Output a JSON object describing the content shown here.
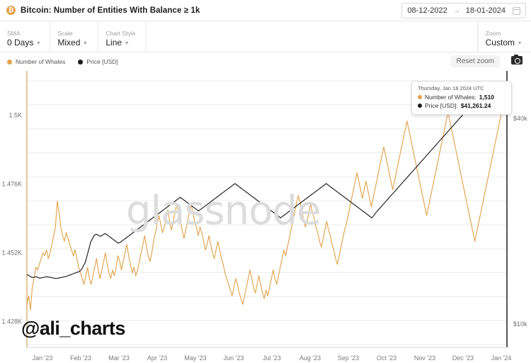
{
  "header": {
    "asset_icon": "bitcoin-icon",
    "title": "Bitcoin: Number of Entities With Balance ≥ 1k",
    "date_from": "08-12-2022",
    "date_to": "18-01-2024",
    "date_arrow": "→",
    "calendar_icon": "calendar-icon"
  },
  "controls": [
    {
      "label": "SMA",
      "value": "0 Days"
    },
    {
      "label": "Scale",
      "value": "Mixed"
    },
    {
      "label": "Chart Style",
      "value": "Line"
    }
  ],
  "zoom_control": {
    "label": "Zoom",
    "value": "Custom"
  },
  "legend": [
    {
      "label": "Number of Whales",
      "color": "#e2a44d"
    },
    {
      "label": "Price [USD]",
      "color": "#1c1c1c"
    }
  ],
  "toolbar": {
    "reset_zoom_label": "Reset zoom",
    "camera_icon": "camera-icon"
  },
  "tooltip": {
    "date": "Thursday, Jan 18 2024 UTC",
    "rows": [
      {
        "label": "Number of Whales:",
        "value": "1,510",
        "color": "#e2a44d"
      },
      {
        "label": "Price [USD]:",
        "value": "$41,261.24",
        "color": "#1c1c1c"
      }
    ]
  },
  "watermark": "glassnode",
  "handle": "@ali_charts",
  "chart_data": {
    "type": "line",
    "title": "Bitcoin: Number of Entities With Balance ≥ 1k",
    "xlabel": "",
    "ylabel": "Number of Whales",
    "y2label": "Price [USD]",
    "grid": true,
    "legend_position": "top-left",
    "x_range": [
      "2022-12-08",
      "2024-01-18"
    ],
    "x_tick_labels": [
      "Jan '23",
      "Feb '23",
      "Mar '23",
      "Apr '23",
      "May '23",
      "Jun '23",
      "Jul '23",
      "Aug '23",
      "Sep '23",
      "Oct '23",
      "Nov '23",
      "Dec '23",
      "Jan '24"
    ],
    "y_left_ticks": [
      "1.5K",
      "1.476K",
      "1.452K",
      "1.428K"
    ],
    "y_left_values": [
      1500,
      1476,
      1452,
      1428
    ],
    "ylim": [
      1420,
      1512
    ],
    "y_right_ticks": [
      "$40k",
      "$10k"
    ],
    "y_right_values": [
      40000,
      10000
    ],
    "y2lim": [
      7000,
      45500
    ],
    "series": [
      {
        "name": "Number of Whales",
        "color": "#e2a44d",
        "axis": "left",
        "values": [
          1434,
          1437,
          1432,
          1440,
          1443,
          1447,
          1446,
          1448,
          1450,
          1452,
          1451,
          1453,
          1450,
          1452,
          1455,
          1458,
          1461,
          1470,
          1466,
          1461,
          1458,
          1456,
          1459,
          1457,
          1455,
          1453,
          1451,
          1453,
          1450,
          1447,
          1445,
          1443,
          1441,
          1444,
          1447,
          1443,
          1441,
          1444,
          1447,
          1450,
          1446,
          1443,
          1446,
          1449,
          1452,
          1448,
          1445,
          1443,
          1446,
          1444,
          1447,
          1451,
          1449,
          1446,
          1449,
          1452,
          1455,
          1451,
          1448,
          1445,
          1447,
          1444,
          1446,
          1449,
          1452,
          1455,
          1458,
          1454,
          1451,
          1449,
          1452,
          1456,
          1459,
          1462,
          1465,
          1462,
          1459,
          1461,
          1464,
          1467,
          1463,
          1460,
          1463,
          1466,
          1469,
          1466,
          1463,
          1460,
          1457,
          1460,
          1463,
          1466,
          1469,
          1466,
          1463,
          1461,
          1458,
          1461,
          1459,
          1456,
          1453,
          1455,
          1458,
          1455,
          1452,
          1450,
          1453,
          1456,
          1453,
          1450,
          1448,
          1445,
          1443,
          1441,
          1439,
          1437,
          1440,
          1443,
          1441,
          1438,
          1436,
          1434,
          1437,
          1440,
          1443,
          1446,
          1443,
          1440,
          1438,
          1441,
          1444,
          1441,
          1438,
          1436,
          1439,
          1437,
          1440,
          1443,
          1446,
          1443,
          1441,
          1444,
          1447,
          1450,
          1453,
          1451,
          1454,
          1457,
          1460,
          1463,
          1466,
          1469,
          1472,
          1470,
          1467,
          1464,
          1461,
          1463,
          1466,
          1469,
          1466,
          1464,
          1461,
          1459,
          1456,
          1454,
          1457,
          1460,
          1463,
          1460,
          1458,
          1455,
          1453,
          1450,
          1448,
          1451,
          1454,
          1457,
          1460,
          1462,
          1465,
          1468,
          1471,
          1474,
          1477,
          1480,
          1477,
          1474,
          1471,
          1474,
          1477,
          1474,
          1471,
          1468,
          1471,
          1474,
          1477,
          1480,
          1483,
          1486,
          1489,
          1486,
          1483,
          1480,
          1477,
          1474,
          1477,
          1480,
          1483,
          1486,
          1489,
          1492,
          1495,
          1498,
          1495,
          1492,
          1489,
          1486,
          1483,
          1480,
          1477,
          1474,
          1471,
          1468,
          1465,
          1468,
          1471,
          1474,
          1477,
          1480,
          1483,
          1486,
          1489,
          1492,
          1495,
          1498,
          1501,
          1498,
          1495,
          1492,
          1489,
          1486,
          1483,
          1480,
          1477,
          1474,
          1471,
          1468,
          1465,
          1462,
          1459,
          1456,
          1459,
          1462,
          1465,
          1468,
          1471,
          1474,
          1477,
          1480,
          1483,
          1486,
          1489,
          1492,
          1495,
          1498,
          1501,
          1504,
          1507,
          1510
        ]
      },
      {
        "name": "Price [USD]",
        "color": "#1c1c1c",
        "axis": "right",
        "values": [
          17200,
          17100,
          16900,
          16800,
          16850,
          16900,
          16800,
          16700,
          16750,
          16800,
          16850,
          16900,
          16850,
          16800,
          16750,
          16700,
          16650,
          16700,
          16750,
          16800,
          16850,
          16900,
          17000,
          17100,
          17200,
          17300,
          17400,
          17500,
          17600,
          17700,
          18000,
          18500,
          19000,
          20000,
          21000,
          22000,
          22500,
          23000,
          23100,
          23000,
          22800,
          22900,
          23100,
          23200,
          23000,
          22800,
          22600,
          22400,
          22200,
          22000,
          21800,
          21900,
          22100,
          22300,
          22500,
          22700,
          22900,
          23100,
          23300,
          23500,
          23700,
          23900,
          24100,
          24300,
          24500,
          24700,
          24900,
          25100,
          25300,
          25500,
          25700,
          25900,
          26100,
          26300,
          26500,
          26700,
          26900,
          27100,
          27300,
          27500,
          27700,
          27900,
          28100,
          28300,
          28500,
          28300,
          28100,
          27900,
          27700,
          27500,
          27300,
          27100,
          26900,
          26700,
          26500,
          26700,
          26900,
          27100,
          27300,
          27500,
          27700,
          27900,
          28100,
          28300,
          28500,
          28700,
          28900,
          29100,
          29300,
          29500,
          29700,
          29900,
          30100,
          30300,
          30500,
          30300,
          30100,
          29900,
          29700,
          29500,
          29300,
          29100,
          28900,
          28700,
          28500,
          28300,
          28100,
          27900,
          27700,
          27500,
          27300,
          27100,
          26900,
          26700,
          26500,
          26300,
          26100,
          25900,
          25700,
          25500,
          25700,
          25900,
          26100,
          26300,
          26500,
          26700,
          26900,
          27100,
          27300,
          27500,
          27700,
          27900,
          28100,
          28300,
          28500,
          28700,
          28900,
          29100,
          29300,
          29500,
          29700,
          29900,
          30100,
          30300,
          30500,
          30300,
          30100,
          29900,
          29700,
          29500,
          29300,
          29100,
          28900,
          28700,
          28500,
          28300,
          28100,
          27900,
          27700,
          27500,
          27300,
          27100,
          26900,
          26700,
          26500,
          26300,
          26100,
          25900,
          25700,
          25500,
          25800,
          26200,
          26500,
          26800,
          27100,
          27400,
          27700,
          28000,
          28300,
          28600,
          28900,
          29200,
          29500,
          29800,
          30100,
          30400,
          30700,
          31000,
          31300,
          31600,
          31900,
          32200,
          32500,
          32800,
          33100,
          33400,
          33700,
          34000,
          34300,
          34600,
          34900,
          35200,
          35500,
          35800,
          36100,
          36400,
          36700,
          37000,
          37300,
          37600,
          37900,
          38200,
          38500,
          38800,
          39100,
          39400,
          39700,
          40000,
          40300,
          40600,
          40900,
          41200,
          41500,
          41800,
          42100,
          42400,
          42700,
          43000,
          43300,
          43600,
          43900,
          44200,
          44500,
          44200,
          43900,
          43600,
          43300,
          43000,
          42700,
          42400,
          42100,
          41800,
          41500,
          41261
        ]
      }
    ],
    "annotations": [
      {
        "kind": "tooltip",
        "date": "Thursday, Jan 18 2024 UTC",
        "whales": 1510,
        "price": 41261.24
      },
      {
        "kind": "watermark",
        "text": "glassnode"
      },
      {
        "kind": "watermark",
        "text": "@ali_charts"
      }
    ]
  }
}
